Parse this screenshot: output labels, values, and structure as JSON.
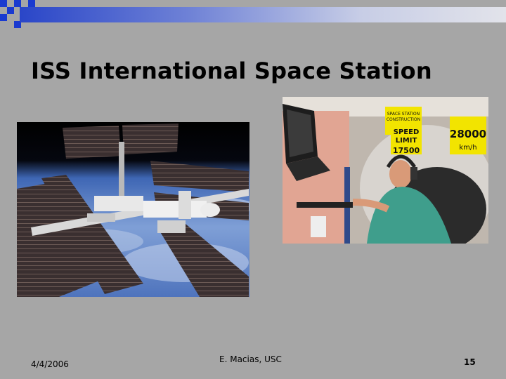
{
  "slide": {
    "title": "ISS International Space Station",
    "footer": {
      "date": "4/4/2006",
      "center": "E. Macias, USC",
      "page_number": "15"
    },
    "photo_crew": {
      "sign_construction": [
        "SPACE STATION",
        "CONSTRUCTION"
      ],
      "sign_speed": [
        "SPEED",
        "LIMIT",
        "17500"
      ],
      "sign_speed_value": "28000",
      "sign_speed_unit": "km/h"
    }
  },
  "colors": {
    "background": "#a6a6a6",
    "accent_blue": "#1a3ad0",
    "sign_yellow": "#f2e400"
  }
}
